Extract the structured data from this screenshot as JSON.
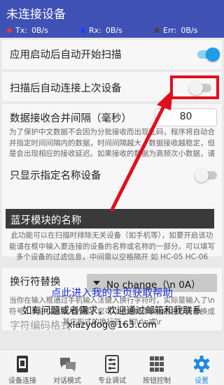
{
  "app": {
    "title": "未连接设备"
  },
  "status": {
    "tx": {
      "label": "Tx:",
      "value": "0B/s",
      "color": "#e53935"
    },
    "rx": {
      "label": "Rx:",
      "value": "0B/s",
      "color": "#1e40ff"
    },
    "err": {
      "label": "Err:",
      "value": "0B/s",
      "color": "#444444"
    }
  },
  "settings": {
    "auto_scan": {
      "label": "应用启动后自动开始扫描",
      "enabled": true
    },
    "auto_connect": {
      "label": "扫描后自动连接上次设备",
      "enabled": false
    },
    "merge_interval": {
      "label": "数据接收合并间隔（毫秒）",
      "value": "80",
      "desc": "为了保护中文数据不会因为分批接收而出现乱码，程序将自动合并指定时间间隔内的数据，时间间隔越大，数据接收越稳定，但是会出现相应的接收延迟。如果接收的数据为高频次小数据，请调小间隔。如果为低频次大数据，则请调大间隔"
    },
    "name_filter": {
      "label": "只显示指定名称设备",
      "enabled": false,
      "placeholder": "蓝牙模块的名称",
      "desc": "此功能可以在扫描时排除无关设备（如手机等），如要开启该功能请在框中输入要连接的设备的名称或名称的一部分。可以填写多个设备的过滤信息，中间需以空格隔开 如 HC-05 HC-06"
    },
    "line_break": {
      "label": "换行符替换",
      "selected": "No change（\\n 0A）",
      "desc": "当你在输入框通过手机输入法键入换行字符时，实际是输入了\\n符号，其它仪器输入的是，您可以选择将你输入的换行符替换成其它形式的换行符，如\\r\\n或\\r"
    },
    "encoding": {
      "label": "字符编码格式"
    }
  },
  "promo": {
    "link": "点此进入我的主页获取帮助",
    "line1": "如有问题或者需求，欢迎通过邮箱和我联系",
    "email": "xlazydog@163.com"
  },
  "tabs": [
    {
      "label": "设备连接",
      "icon": "device-icon"
    },
    {
      "label": "对话模式",
      "icon": "chat-icon"
    },
    {
      "label": "专业调试",
      "icon": "debug-icon"
    },
    {
      "label": "按钮控制",
      "icon": "keypad-icon"
    },
    {
      "label": "设置",
      "icon": "gear-icon",
      "active": true
    }
  ],
  "colors": {
    "primary": "#3f51b5",
    "accent": "#1e9bea",
    "annotation": "#e40d1e"
  }
}
